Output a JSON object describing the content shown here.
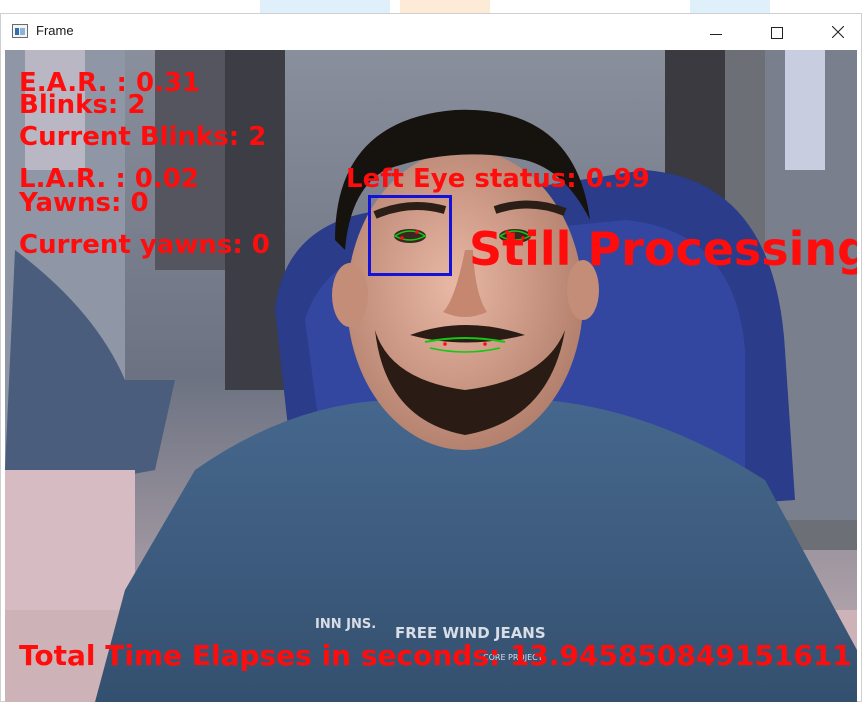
{
  "window": {
    "title": "Frame"
  },
  "overlay": {
    "ear": "E.A.R. : 0.31",
    "blinks": "Blinks: 2",
    "current_blinks": "Current Blinks: 2",
    "lar": "L.A.R. : 0.02",
    "yawns": "Yawns: 0",
    "current_yawns": "Current yawns: 0",
    "left_eye_status": "Left Eye status: 0.99",
    "processing": "Still Processing",
    "total_time": "Total Time Elapses in seconds: 13.945850849151611"
  },
  "shirt_print": {
    "line1": "INN JNS.",
    "line2": "FREE WIND JEANS",
    "line3": "CORE PROJECT"
  },
  "colors": {
    "overlay_text": "#ff0d0d",
    "face_box": "#1212d8",
    "landmarks": "#12c812",
    "shirt": "#3f5f84",
    "chair": "#2a3c8a"
  },
  "icons": {
    "app": "opencv-window-icon",
    "minimize": "minimize-icon",
    "maximize": "maximize-icon",
    "close": "close-icon"
  }
}
